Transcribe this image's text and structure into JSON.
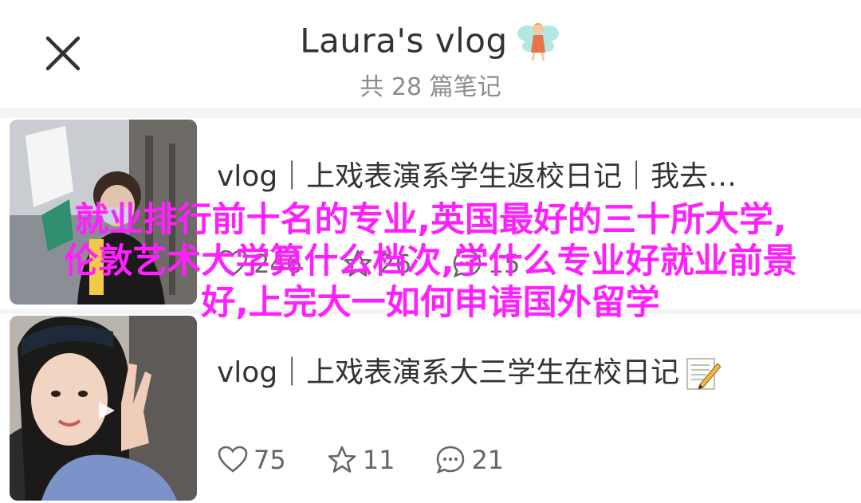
{
  "header": {
    "title": "Laura's vlog",
    "title_emoji": "fairy-icon",
    "subtitle": "共 28 篇笔记"
  },
  "notes": [
    {
      "title": "vlog｜上戏表演系学生返校日记｜我去…",
      "likes": "246",
      "collects": "26",
      "comments": "15",
      "is_video": false
    },
    {
      "title": "vlog｜上戏表演系大三学生在校日记",
      "title_emoji": "notepad-icon",
      "likes": "75",
      "collects": "11",
      "comments": "21",
      "is_video": true
    }
  ],
  "overlay": {
    "line1": "就业排行前十名的专业,英国最好的三十所大学,",
    "line2": "伦敦艺术大学算什么档次,学什么专业好就业前景",
    "line3": "好,上完大一如何申请国外留学",
    "color": "#ff1fff"
  }
}
